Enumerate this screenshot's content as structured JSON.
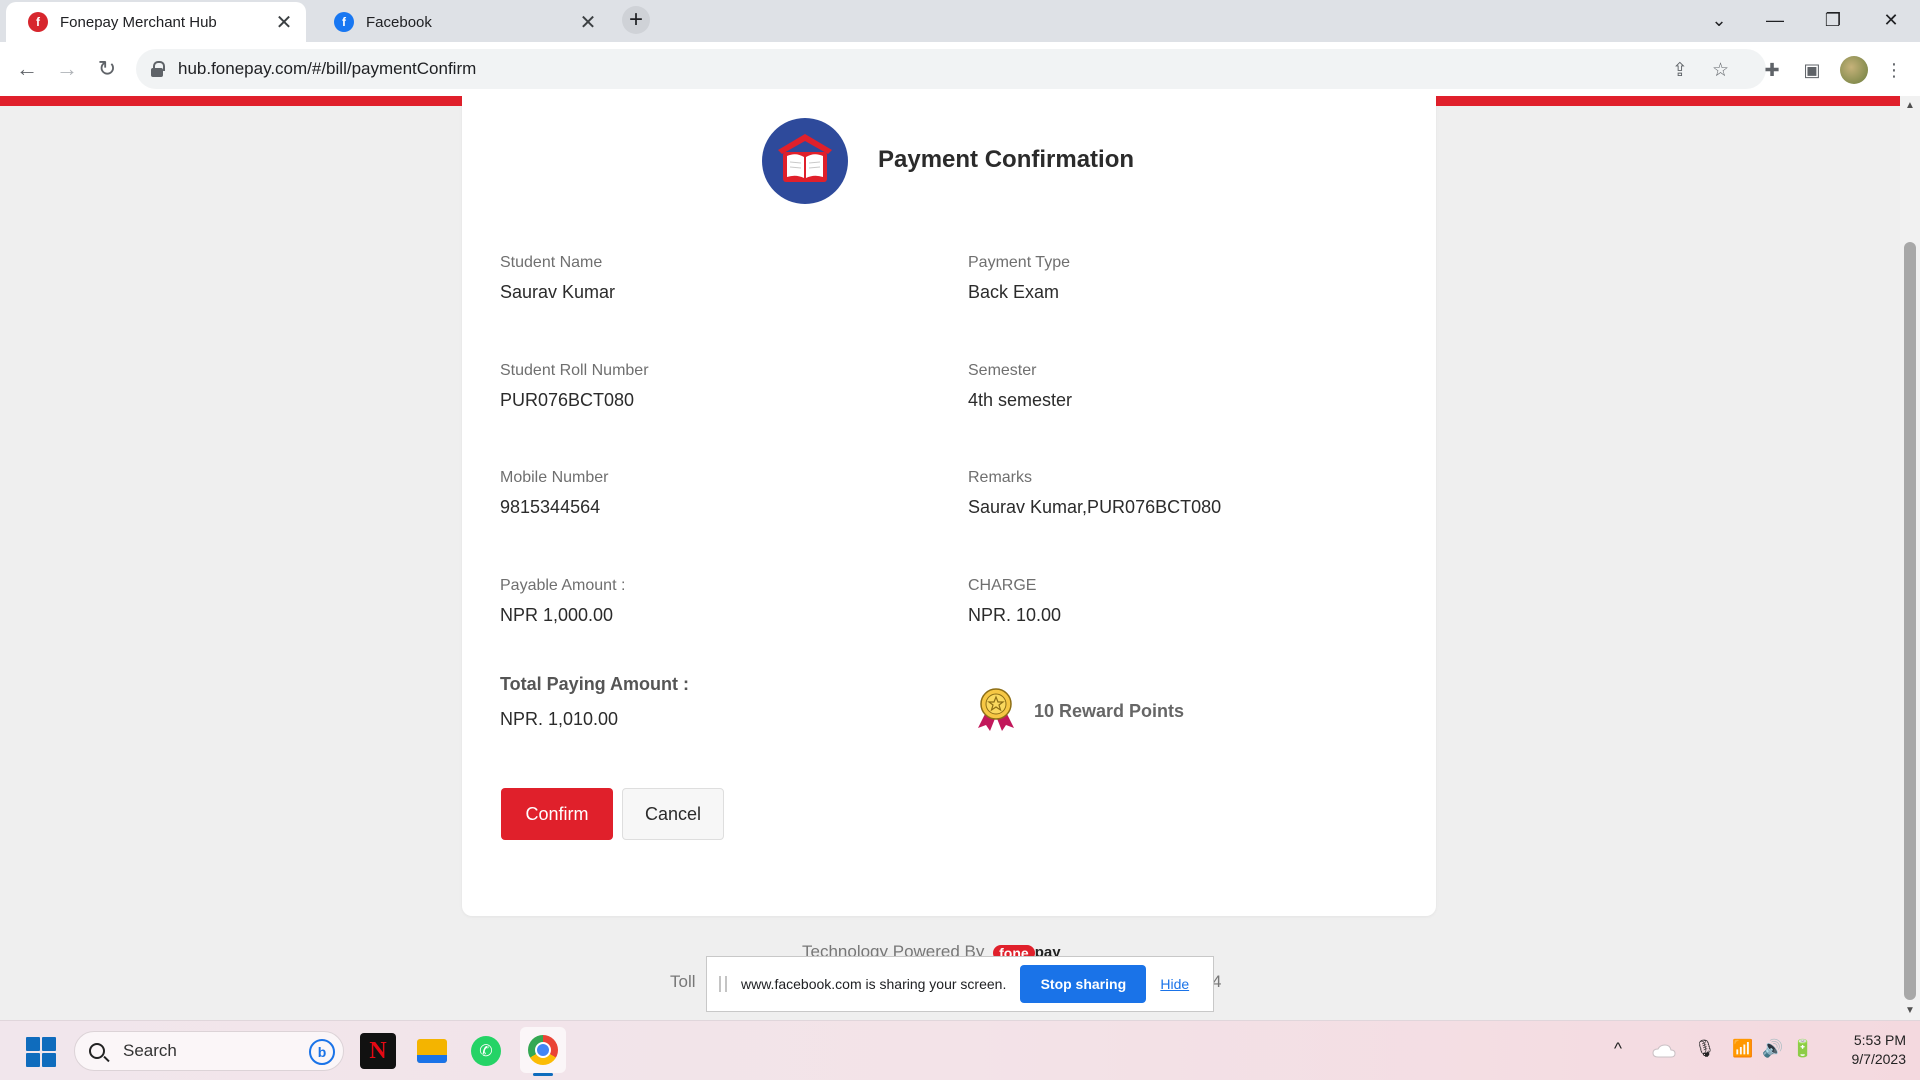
{
  "browser": {
    "tabs": [
      {
        "title": "Fonepay Merchant Hub",
        "favicon": "fonepay-icon",
        "active": true
      },
      {
        "title": "Facebook",
        "favicon": "facebook-icon",
        "active": false
      }
    ],
    "close_glyph": "✕",
    "new_tab_glyph": "+",
    "url": "hub.fonepay.com/#/bill/paymentConfirm",
    "window_controls": {
      "dropdown": "⌄",
      "minimize": "—",
      "maximize": "❐",
      "close": "✕"
    }
  },
  "page": {
    "title": "Payment Confirmation",
    "fields": {
      "student_name": {
        "label": "Student Name",
        "value": "Saurav Kumar"
      },
      "payment_type": {
        "label": "Payment Type",
        "value": "Back Exam"
      },
      "roll_number": {
        "label": "Student Roll Number",
        "value": "PUR076BCT080"
      },
      "semester": {
        "label": "Semester",
        "value": "4th semester"
      },
      "mobile": {
        "label": "Mobile Number",
        "value": "9815344564"
      },
      "remarks": {
        "label": "Remarks",
        "value": "Saurav Kumar,PUR076BCT080"
      },
      "payable": {
        "label": "Payable Amount :",
        "value": "NPR 1,000.00"
      },
      "charge": {
        "label": "CHARGE",
        "value": "NPR. 10.00"
      },
      "total": {
        "label": "Total Paying Amount :",
        "value": "NPR. 1,010.00"
      }
    },
    "reward_text": "10 Reward Points",
    "buttons": {
      "confirm": "Confirm",
      "cancel": "Cancel"
    },
    "footer": {
      "line1_text": "Technology Powered By",
      "logo_part1": "fone",
      "logo_part2": "pay",
      "line2_start": "Toll",
      "line2_end": "4"
    },
    "share_bar": {
      "message": "www.facebook.com is sharing your screen.",
      "stop": "Stop sharing",
      "hide": "Hide"
    },
    "accent_color": "#e0202b"
  },
  "taskbar": {
    "search_placeholder": "Search",
    "bing_glyph": "b",
    "netflix_glyph": "N",
    "whatsapp_glyph": "✆",
    "tray": {
      "chevron": "^",
      "mic": "🎙",
      "wifi": "📶",
      "volume": "🔊",
      "battery": "🔋"
    },
    "time": "5:53 PM",
    "date": "9/7/2023"
  }
}
